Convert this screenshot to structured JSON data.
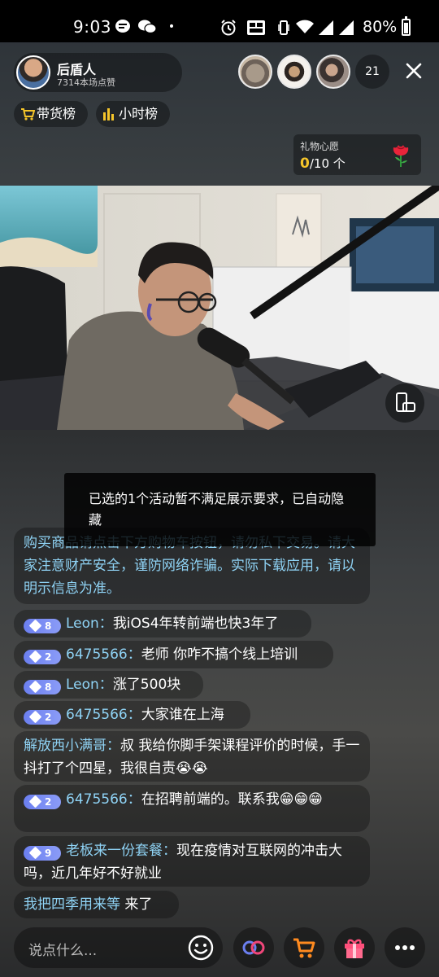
{
  "status_bar": {
    "time": "9:03",
    "battery": "80%"
  },
  "host": {
    "name": "后盾人",
    "likes": "7314本场点赞"
  },
  "viewers": {
    "count": "21"
  },
  "ranks": {
    "sales": "带货榜",
    "hourly": "小时榜"
  },
  "gift_wish": {
    "title": "礼物心愿",
    "current": "0",
    "total": "/10 个"
  },
  "toast": {
    "message": "已选的1个活动暂不满足展示要求，已自动隐藏"
  },
  "chat": {
    "system_notice": "购买商品请点击下方购物车按钮，请勿私下交易。请大家注意财产安全，谨防网络诈骗。实际下载应用，请以明示信息为准。",
    "messages": [
      {
        "level": "8",
        "name": "Leon：",
        "text": "我iOS4年转前端也快3年了"
      },
      {
        "level": "2",
        "name": "6475566：",
        "text": "老师 你咋不搞个线上培训"
      },
      {
        "level": "8",
        "name": "Leon：",
        "text": "涨了500块"
      },
      {
        "level": "2",
        "name": "6475566：",
        "text": "大家谁在上海"
      },
      {
        "name": "解放西小满哥：",
        "text": "叔 我给你脚手架课程评价的时候，手一抖打了个四星，我很自责😭😭"
      },
      {
        "level": "2",
        "name": "6475566：",
        "text": "在招聘前端的。联系我😁😁😁"
      },
      {
        "level": "9",
        "name": "老板来一份套餐：",
        "text": "现在疫情对互联网的冲击大吗，近几年好不好就业"
      },
      {
        "name": "我把四季用来等",
        "text": " 来了"
      }
    ]
  },
  "input": {
    "placeholder": "说点什么..."
  }
}
